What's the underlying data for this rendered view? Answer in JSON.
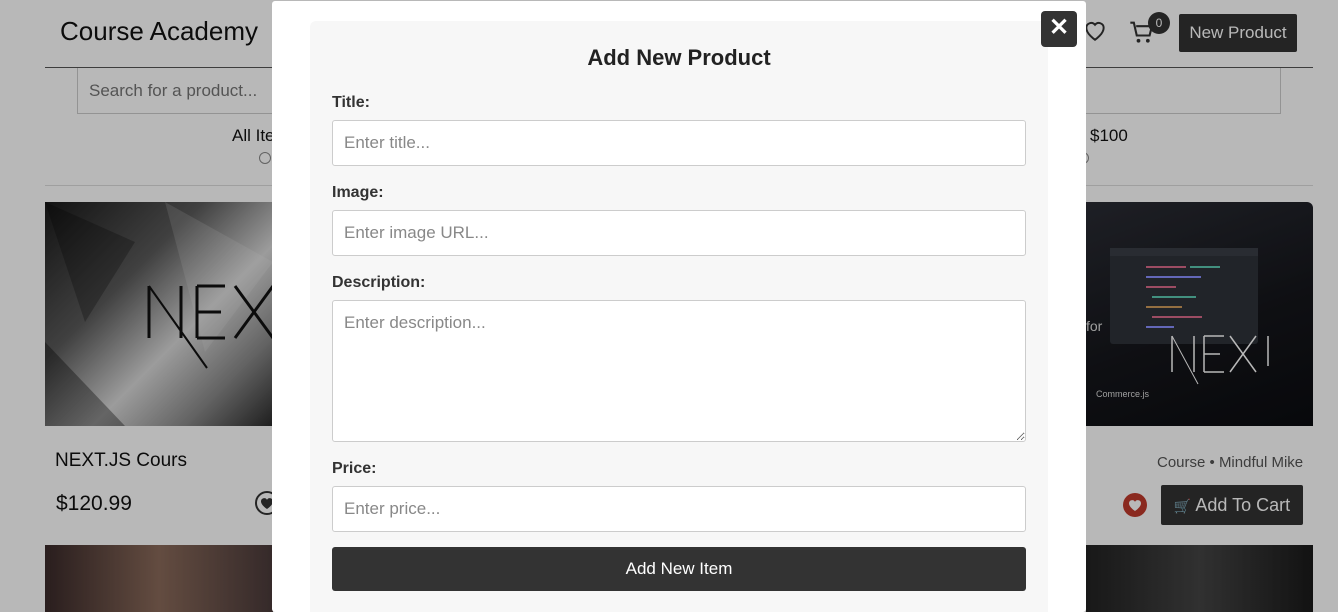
{
  "app": {
    "brand": "Course Academy",
    "cart_count": "0",
    "new_product_label": "New Product"
  },
  "search": {
    "placeholder": "Search for a product..."
  },
  "filters": {
    "left_label": "All Ite",
    "right_label": "$100"
  },
  "products": [
    {
      "title": "NEXT.JS Cours",
      "price": "$120.99"
    },
    {
      "meta": "Course • Mindful Mike",
      "add_to_cart": "Add To Cart",
      "image_caption_small": "Commerce.js",
      "image_word": "for"
    }
  ],
  "modal": {
    "close_symbol": "✕",
    "title": "Add New Product",
    "fields": {
      "title": {
        "label": "Title:",
        "placeholder": "Enter title..."
      },
      "image": {
        "label": "Image:",
        "placeholder": "Enter image URL..."
      },
      "description": {
        "label": "Description:",
        "placeholder": "Enter description..."
      },
      "price": {
        "label": "Price:",
        "placeholder": "Enter price..."
      }
    },
    "submit_label": "Add New Item"
  },
  "colors": {
    "dark": "#333333",
    "heart_red": "#c0392b",
    "overlay": "rgba(0,0,0,0.28)"
  }
}
